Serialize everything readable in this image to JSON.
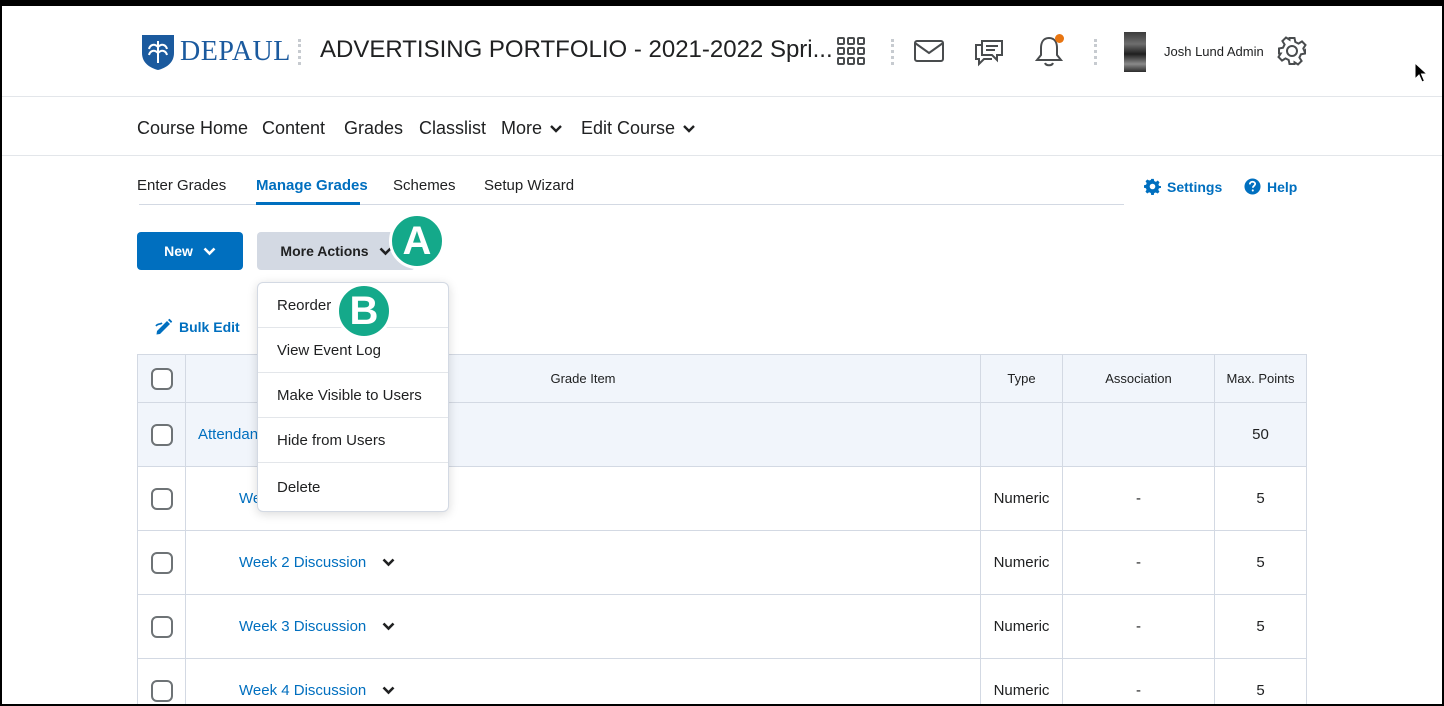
{
  "header": {
    "logo_text": "DEPAUL",
    "course_title": "ADVERTISING PORTFOLIO - 2021-2022 Spri...",
    "user_name": "Josh Lund Admin",
    "notification_dot_color": "#e87511",
    "icons": [
      "waffle-grid-icon",
      "mail-icon",
      "chat-icon",
      "bell-icon",
      "gear-icon"
    ]
  },
  "nav": {
    "items": [
      {
        "label": "Course Home"
      },
      {
        "label": "Content"
      },
      {
        "label": "Grades"
      },
      {
        "label": "Classlist"
      },
      {
        "label": "More"
      },
      {
        "label": "Edit Course"
      }
    ]
  },
  "subtabs": {
    "items": [
      {
        "label": "Enter Grades"
      },
      {
        "label": "Manage Grades"
      },
      {
        "label": "Schemes"
      },
      {
        "label": "Setup Wizard"
      }
    ],
    "active": "Manage Grades",
    "settings_label": "Settings",
    "help_label": "Help"
  },
  "toolbar": {
    "new_label": "New",
    "more_actions_label": "More Actions",
    "bulk_edit_label": "Bulk Edit"
  },
  "callouts": {
    "a": "A",
    "b": "B"
  },
  "menu": {
    "items": [
      {
        "label": "Reorder"
      },
      {
        "label": "View Event Log"
      },
      {
        "label": "Make Visible to Users"
      },
      {
        "label": "Hide from Users"
      },
      {
        "label": "Delete"
      }
    ]
  },
  "table": {
    "headers": {
      "item": "Grade Item",
      "type": "Type",
      "association": "Association",
      "max": "Max. Points"
    },
    "rows": [
      {
        "name": "Attendan",
        "type": "",
        "association": "",
        "max": "50"
      },
      {
        "name": "We",
        "type": "Numeric",
        "association": "-",
        "max": "5"
      },
      {
        "name": "Week 2 Discussion",
        "type": "Numeric",
        "association": "-",
        "max": "5"
      },
      {
        "name": "Week 3 Discussion",
        "type": "Numeric",
        "association": "-",
        "max": "5"
      },
      {
        "name": "Week 4 Discussion",
        "type": "Numeric",
        "association": "-",
        "max": "5"
      }
    ]
  },
  "colors": {
    "accent": "#006fbf",
    "callout": "#14a98a",
    "header_bg": "#f1f5fb"
  }
}
